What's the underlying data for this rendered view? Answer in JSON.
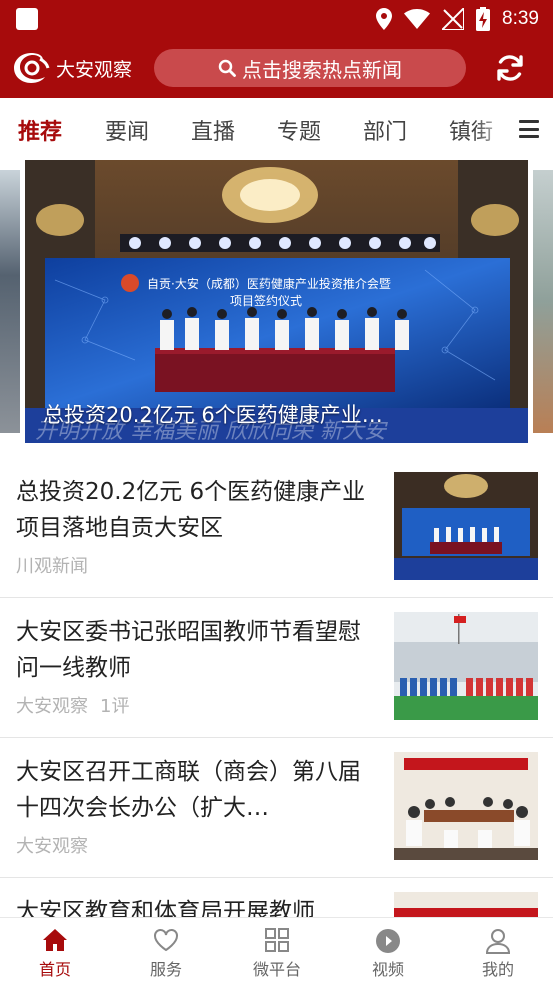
{
  "status_bar": {
    "time": "8:39",
    "icons": [
      "location-icon",
      "wifi-icon",
      "no-signal-icon",
      "battery-charging-icon"
    ]
  },
  "header": {
    "logo_text": "大安观察",
    "search_placeholder": "点击搜索热点新闻",
    "refresh_icon": "refresh-icon"
  },
  "tabs": [
    {
      "label": "推荐",
      "active": true
    },
    {
      "label": "要闻",
      "active": false
    },
    {
      "label": "直播",
      "active": false
    },
    {
      "label": "专题",
      "active": false
    },
    {
      "label": "部门",
      "active": false
    },
    {
      "label": "镇街",
      "active": false
    }
  ],
  "banner": {
    "caption": "总投资20.2亿元 6个医药健康产业…",
    "screen_text_1": "自贡·大安（成都）医药健康产业投资推介会暨",
    "screen_text_2": "项目签约仪式",
    "backdrop_text": "开明开放  幸福美丽  欣欣向荣  新大安"
  },
  "news": [
    {
      "title": "总投资20.2亿元 6个医药健康产业项目落地自贡大安区",
      "source": "川观新闻",
      "comments": ""
    },
    {
      "title": "大安区委书记张昭国教师节看望慰问一线教师",
      "source": "大安观察",
      "comments": "1评"
    },
    {
      "title": "大安区召开工商联（商会）第八届十四次会长办公（扩大…",
      "source": "大安观察",
      "comments": ""
    },
    {
      "title": "大安区教育和体育局开展教师",
      "source": "",
      "comments": ""
    }
  ],
  "bottom_nav": [
    {
      "label": "首页",
      "icon": "home-icon",
      "active": true
    },
    {
      "label": "服务",
      "icon": "heart-icon",
      "active": false
    },
    {
      "label": "微平台",
      "icon": "grid-icon",
      "active": false
    },
    {
      "label": "视频",
      "icon": "play-icon",
      "active": false
    },
    {
      "label": "我的",
      "icon": "user-icon",
      "active": false
    }
  ],
  "colors": {
    "brand": "#a70b0c",
    "search_bg": "#c94a4c",
    "meta_text": "#b3b3b3"
  }
}
